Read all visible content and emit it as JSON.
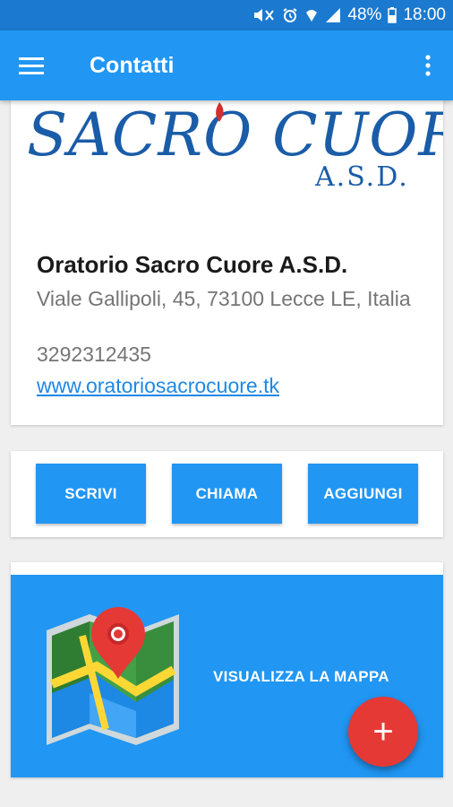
{
  "status_bar": {
    "battery": "48%",
    "time": "18:00",
    "icons": [
      "mute-icon",
      "alarm-icon",
      "wifi-icon",
      "signal-icon",
      "battery-icon"
    ]
  },
  "app_bar": {
    "title": "Contatti",
    "menu_icon": "hamburger-menu-icon",
    "more_icon": "more-vert-icon"
  },
  "contact": {
    "logo_text": "SACRO CUORE",
    "logo_subtext": "A.S.D.",
    "name": "Oratorio Sacro Cuore A.S.D.",
    "address": "Viale Gallipoli, 45, 73100 Lecce LE, Italia",
    "phone": "3292312435",
    "website": "www.oratoriosacrocuore.tk"
  },
  "actions": {
    "write_label": "SCRIVI",
    "call_label": "CHIAMA",
    "add_label": "AGGIUNGI"
  },
  "map": {
    "label": "VISUALIZZA LA MAPPA",
    "icon": "map-pin-icon"
  },
  "fab": {
    "label": "+",
    "icon": "add-icon"
  },
  "colors": {
    "primary": "#2196f3",
    "primary_dark": "#1b79cf",
    "accent": "#e53935",
    "link": "#1e88e5"
  }
}
